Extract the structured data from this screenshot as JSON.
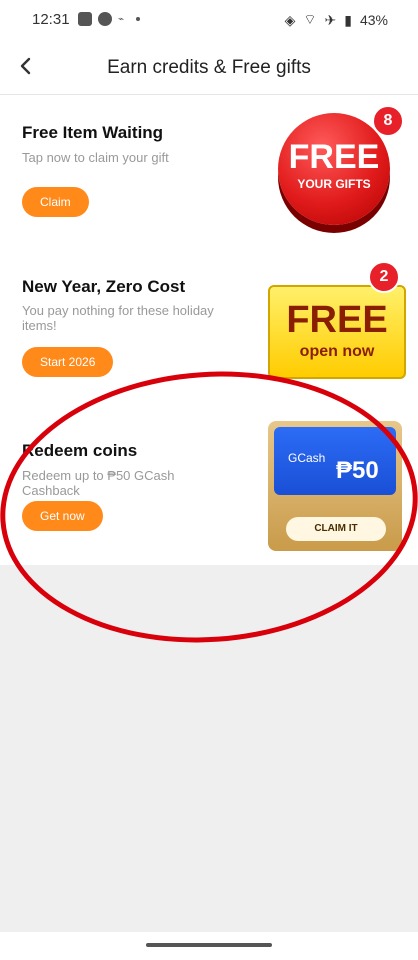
{
  "status": {
    "time": "12:31",
    "battery": "43%"
  },
  "header": {
    "title": "Earn credits & Free gifts"
  },
  "cards": [
    {
      "title": "Free Item Waiting",
      "subtitle": "Tap now to claim your gift",
      "button": "Claim",
      "art": {
        "main_text": "FREE",
        "sub_text": "YOUR GIFTS",
        "badge": "8"
      }
    },
    {
      "title": "New Year, Zero Cost",
      "subtitle": "You pay nothing for these holiday items!",
      "button": "Start 2026",
      "art": {
        "main_text": "FREE",
        "sub_text": "open now",
        "badge": "2"
      }
    },
    {
      "title": "Redeem coins",
      "subtitle": "Redeem up to ₱50 GCash Cashback",
      "button": "Get now",
      "art": {
        "brand": "GCash",
        "amount": "₱50",
        "claim": "CLAIM IT"
      }
    }
  ],
  "colors": {
    "accent": "#ff8a1a",
    "annotation": "#d8000a"
  }
}
